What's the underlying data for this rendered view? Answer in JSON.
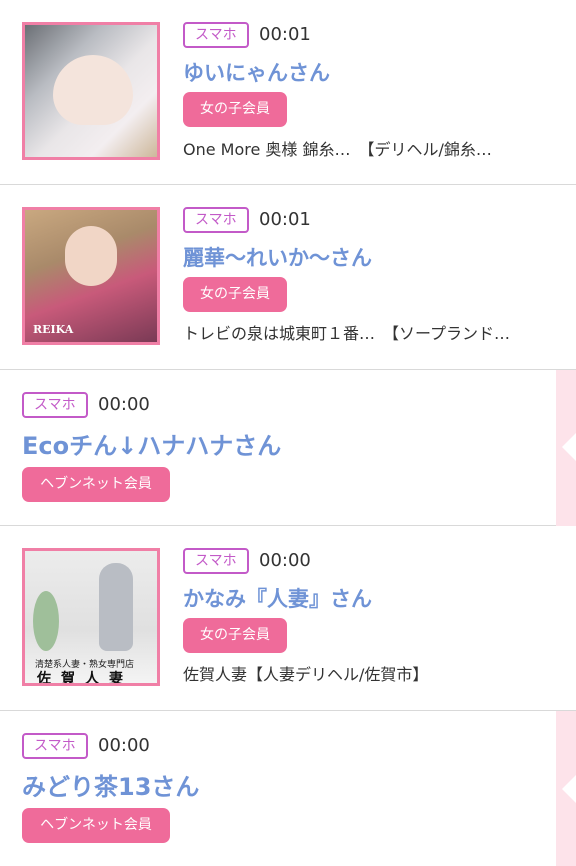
{
  "entries": [
    {
      "device": "スマホ",
      "time": "00:01",
      "name": "ゆいにゃんさん",
      "member": "女の子会員",
      "shop": "One More 奥様 錦糸…　【デリヘル/錦糸…"
    },
    {
      "device": "スマホ",
      "time": "00:01",
      "name": "麗華〜れいか〜さん",
      "member": "女の子会員",
      "shop": "トレビの泉は城東町１番…　【ソープランド…",
      "thumb_label": "REIKA"
    },
    {
      "device": "スマホ",
      "time": "00:00",
      "name": "Ecoチん↓ハナハナさん",
      "member": "ヘブンネット会員"
    },
    {
      "device": "スマホ",
      "time": "00:00",
      "name": "かなみ『人妻』さん",
      "member": "女の子会員",
      "shop": "佐賀人妻【人妻デリヘル/佐賀市】",
      "thumb_caption_small": "清楚系人妻・熟女専門店",
      "thumb_caption_big": "佐賀人妻"
    },
    {
      "device": "スマホ",
      "time": "00:00",
      "name": "みどり茶13さん",
      "member": "ヘブンネット会員"
    }
  ],
  "colors": {
    "accent_pink": "#ef6b9a",
    "name_blue": "#6f93d6",
    "device_purple": "#c35ac8",
    "thumb_border": "#f07fa6"
  },
  "icons": [
    "side-arrow-icon"
  ]
}
